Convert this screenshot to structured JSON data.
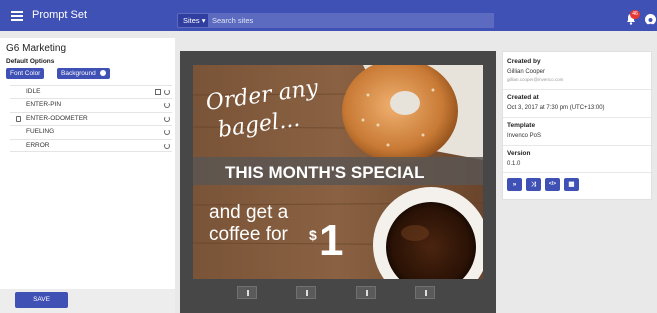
{
  "header": {
    "app_title": "Prompt Set",
    "sites_label": "Sites ▾",
    "search_placeholder": "Search sites",
    "notification_count": "46"
  },
  "left": {
    "title": "G6 Marketing",
    "default_options": "Default Options",
    "font_color": "Font Color",
    "background": "Background",
    "states": [
      {
        "label": "IDLE"
      },
      {
        "label": "ENTER-PIN"
      },
      {
        "label": "ENTER-ODOMETER"
      },
      {
        "label": "FUELING"
      },
      {
        "label": "ERROR"
      }
    ],
    "save_label": "SAVE"
  },
  "screen": {
    "line1": "Order any",
    "line2": "bagel...",
    "banner": "THIS MONTH'S SPECIAL",
    "line3": "and get a",
    "line4": "coffee for",
    "currency": "$",
    "amount": "1"
  },
  "info": {
    "created_by_label": "Created by",
    "created_by_name": "Gillian Cooper",
    "created_by_email": "gillian.cooper@invenco.com",
    "created_at_label": "Created at",
    "created_at_value": "Oct 3, 2017 at 7:30 pm (UTC+13:00)",
    "template_label": "Template",
    "template_value": "Invenco PoS",
    "version_label": "Version",
    "version_value": "0.1.0",
    "actions": [
      {
        "icon": "double-chevron-icon",
        "glyph": "»"
      },
      {
        "icon": "shuffle-icon",
        "glyph": "⤨"
      },
      {
        "icon": "code-icon",
        "glyph": "</>"
      },
      {
        "icon": "grid-icon",
        "glyph": "▦"
      }
    ]
  },
  "colors": {
    "primary": "#3f51b5",
    "primary_dark": "#303f9f",
    "notification": "#e53935"
  }
}
